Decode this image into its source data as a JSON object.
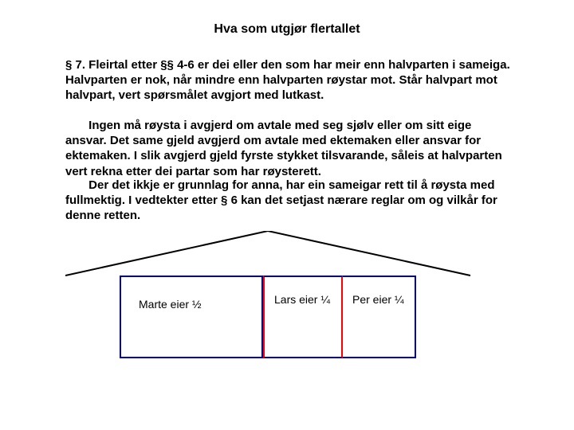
{
  "title": "Hva som utgjør flertallet",
  "paragraphs": {
    "p1": "§ 7. Fleirtal etter §§ 4-6 er dei eller den som har meir enn halvparten i sameiga. Halvparten er nok, når mindre enn halvparten røystar mot. Står halvpart mot halvpart, vert spørsmålet avgjort med lutkast.",
    "p2": "       Ingen må røysta i avgjerd om avtale med seg sjølv eller om sitt eige ansvar. Det same gjeld avgjerd om avtale med ektemaken eller ansvar for ektemaken. I slik avgjerd gjeld fyrste stykket tilsvarande, såleis at halvparten vert rekna etter dei partar som har røysterett.",
    "p3": "       Der det ikkje er grunnlag for anna, har ein sameigar rett til å røysta med fullmektig. I vedtekter etter § 6 kan det setjast nærare reglar om og vilkår for denne retten."
  },
  "house": {
    "marte": "Marte eier ½",
    "lars": "Lars eier ¼",
    "per": "Per eier ¼"
  }
}
